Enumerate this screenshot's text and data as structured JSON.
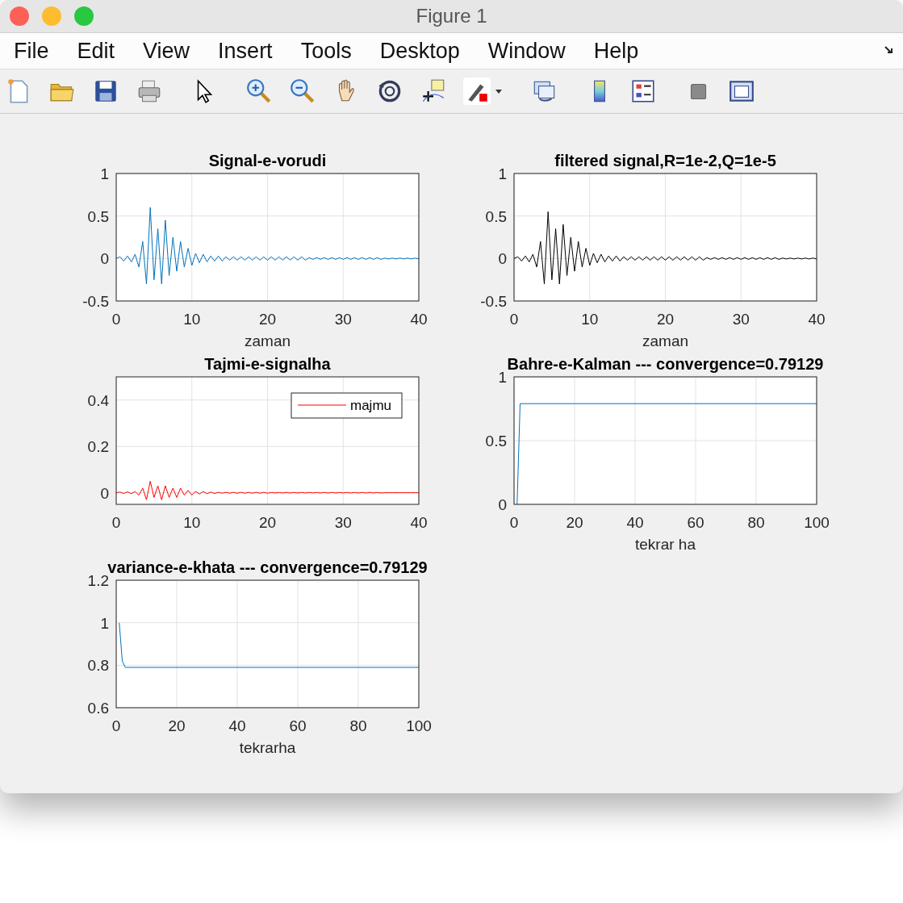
{
  "window": {
    "title": "Figure 1"
  },
  "menu": [
    "File",
    "Edit",
    "View",
    "Insert",
    "Tools",
    "Desktop",
    "Window",
    "Help"
  ],
  "plots": [
    {
      "chart_data": {
        "type": "line",
        "title": "Signal-e-vorudi",
        "xlabel": "zaman",
        "grid": true,
        "x": [
          0,
          0.5,
          1,
          1.5,
          2,
          2.5,
          3,
          3.5,
          4,
          4.5,
          5,
          5.5,
          6,
          6.5,
          7,
          7.5,
          8,
          8.5,
          9,
          9.5,
          10,
          10.5,
          11,
          11.5,
          12,
          12.5,
          13,
          13.5,
          14,
          14.5,
          15,
          15.5,
          16,
          16.5,
          17,
          17.5,
          18,
          18.5,
          19,
          19.5,
          20,
          20.5,
          21,
          21.5,
          22,
          22.5,
          23,
          23.5,
          24,
          24.5,
          25,
          25.5,
          26,
          26.5,
          27,
          27.5,
          28,
          28.5,
          29,
          29.5,
          30,
          30.5,
          31,
          31.5,
          32,
          32.5,
          33,
          33.5,
          34,
          34.5,
          35,
          35.5,
          36,
          36.5,
          37,
          37.5,
          38,
          38.5,
          39,
          39.5,
          40
        ],
        "xlim": [
          0,
          40
        ],
        "ylim": [
          -0.5,
          1
        ],
        "xticks": [
          0,
          10,
          20,
          30,
          40
        ],
        "yticks": [
          -0.5,
          0,
          0.5,
          1
        ],
        "series": [
          {
            "color": "#0072bd",
            "values": [
              0,
              0.02,
              -0.03,
              0.03,
              -0.04,
              0.05,
              -0.1,
              0.2,
              -0.3,
              0.6,
              -0.25,
              0.35,
              -0.3,
              0.45,
              -0.2,
              0.25,
              -0.15,
              0.2,
              -0.1,
              0.12,
              -0.08,
              0.06,
              -0.05,
              0.05,
              -0.04,
              0.03,
              -0.03,
              0.03,
              -0.03,
              0.02,
              -0.02,
              0.02,
              -0.02,
              0.02,
              -0.02,
              0.02,
              -0.02,
              0.02,
              -0.02,
              0.02,
              -0.02,
              0.02,
              -0.02,
              0.02,
              -0.02,
              0.02,
              -0.02,
              0.02,
              -0.02,
              0.02,
              -0.02,
              0.01,
              -0.01,
              0.01,
              -0.01,
              0.01,
              -0.01,
              0.01,
              -0.01,
              0.01,
              -0.01,
              0.01,
              -0.01,
              0.01,
              -0.01,
              0.01,
              -0.01,
              0.01,
              -0.01,
              0.01,
              -0.01,
              0.005,
              -0.005,
              0.005,
              -0.005,
              0.005,
              -0.005,
              0.005,
              -0.005,
              0.005,
              -0.005
            ]
          }
        ]
      }
    },
    {
      "chart_data": {
        "type": "line",
        "title": "filtered signal,R=1e-2,Q=1e-5",
        "xlabel": "zaman",
        "grid": true,
        "x": [
          0,
          0.5,
          1,
          1.5,
          2,
          2.5,
          3,
          3.5,
          4,
          4.5,
          5,
          5.5,
          6,
          6.5,
          7,
          7.5,
          8,
          8.5,
          9,
          9.5,
          10,
          10.5,
          11,
          11.5,
          12,
          12.5,
          13,
          13.5,
          14,
          14.5,
          15,
          15.5,
          16,
          16.5,
          17,
          17.5,
          18,
          18.5,
          19,
          19.5,
          20,
          20.5,
          21,
          21.5,
          22,
          22.5,
          23,
          23.5,
          24,
          24.5,
          25,
          25.5,
          26,
          26.5,
          27,
          27.5,
          28,
          28.5,
          29,
          29.5,
          30,
          30.5,
          31,
          31.5,
          32,
          32.5,
          33,
          33.5,
          34,
          34.5,
          35,
          35.5,
          36,
          36.5,
          37,
          37.5,
          38,
          38.5,
          39,
          39.5,
          40
        ],
        "xlim": [
          0,
          40
        ],
        "ylim": [
          -0.5,
          1
        ],
        "xticks": [
          0,
          10,
          20,
          30,
          40
        ],
        "yticks": [
          -0.5,
          0,
          0.5,
          1
        ],
        "series": [
          {
            "color": "#000000",
            "values": [
              0,
              0.02,
              -0.03,
              0.03,
              -0.04,
              0.05,
              -0.1,
              0.2,
              -0.3,
              0.55,
              -0.25,
              0.35,
              -0.3,
              0.4,
              -0.2,
              0.25,
              -0.15,
              0.2,
              -0.1,
              0.12,
              -0.08,
              0.06,
              -0.05,
              0.05,
              -0.04,
              0.03,
              -0.03,
              0.03,
              -0.03,
              0.02,
              -0.02,
              0.02,
              -0.02,
              0.02,
              -0.02,
              0.02,
              -0.02,
              0.02,
              -0.02,
              0.02,
              -0.02,
              0.02,
              -0.02,
              0.02,
              -0.02,
              0.02,
              -0.02,
              0.02,
              -0.02,
              0.02,
              -0.02,
              0.01,
              -0.01,
              0.01,
              -0.01,
              0.01,
              -0.01,
              0.01,
              -0.01,
              0.01,
              -0.01,
              0.01,
              -0.01,
              0.01,
              -0.01,
              0.01,
              -0.01,
              0.01,
              -0.01,
              0.01,
              -0.01,
              0.005,
              -0.005,
              0.005,
              -0.005,
              0.005,
              -0.005,
              0.005,
              -0.005,
              0.005,
              -0.005
            ]
          }
        ]
      }
    },
    {
      "chart_data": {
        "type": "line",
        "title": "Tajmi-e-signalha",
        "grid": true,
        "x": [
          0,
          0.5,
          1,
          1.5,
          2,
          2.5,
          3,
          3.5,
          4,
          4.5,
          5,
          5.5,
          6,
          6.5,
          7,
          7.5,
          8,
          8.5,
          9,
          9.5,
          10,
          10.5,
          11,
          11.5,
          12,
          12.5,
          13,
          13.5,
          14,
          14.5,
          15,
          15.5,
          16,
          16.5,
          17,
          17.5,
          18,
          18.5,
          19,
          19.5,
          20,
          20.5,
          21,
          21.5,
          22,
          22.5,
          23,
          23.5,
          24,
          24.5,
          25,
          25.5,
          26,
          26.5,
          27,
          27.5,
          28,
          28.5,
          29,
          29.5,
          30,
          30.5,
          31,
          31.5,
          32,
          32.5,
          33,
          33.5,
          34,
          34.5,
          35,
          35.5,
          36,
          36.5,
          37,
          37.5,
          38,
          38.5,
          39,
          39.5,
          40
        ],
        "xlim": [
          0,
          40
        ],
        "ylim": [
          -0.05,
          0.5
        ],
        "xticks": [
          0,
          10,
          20,
          30,
          40
        ],
        "yticks": [
          0,
          0.2,
          0.4
        ],
        "series": [
          {
            "name": "majmu",
            "color": "#ff0000",
            "values": [
              0,
              0.003,
              -0.003,
              0.004,
              -0.004,
              0.005,
              -0.01,
              0.02,
              -0.03,
              0.05,
              -0.02,
              0.03,
              -0.03,
              0.03,
              -0.02,
              0.02,
              -0.02,
              0.02,
              -0.01,
              0.01,
              -0.01,
              0.006,
              -0.005,
              0.005,
              -0.004,
              0.003,
              -0.003,
              0.002,
              -0.002,
              0.002,
              -0.002,
              0.002,
              -0.002,
              0.002,
              -0.002,
              0.002,
              -0.002,
              0.002,
              -0.002,
              0.002,
              -0.002,
              0.001,
              -0.001,
              0.001,
              -0.001,
              0.001,
              -0.001,
              0.001,
              -0.001,
              0.001,
              -0.001,
              0.001,
              -0.001,
              0.001,
              -0.001,
              0.001,
              -0.001,
              0.001,
              -0.001,
              0.001,
              -0.001,
              0.001,
              -0.001,
              0.001,
              -0.001,
              0.001,
              -0.001,
              0.001,
              -0.001,
              0.001,
              -0.001,
              0,
              0,
              0,
              0,
              0,
              0,
              0,
              0,
              0,
              0
            ]
          }
        ]
      }
    },
    {
      "chart_data": {
        "type": "line",
        "title": "Bahre-e-Kalman --- convergence=0.79129",
        "xlabel": "tekrar ha",
        "grid": true,
        "x": [
          1,
          2,
          100
        ],
        "xlim": [
          0,
          100
        ],
        "ylim": [
          0,
          1
        ],
        "xticks": [
          0,
          20,
          40,
          60,
          80,
          100
        ],
        "yticks": [
          0,
          0.5,
          1
        ],
        "series": [
          {
            "color": "#0072bd",
            "values": [
              0,
              0.79,
              0.79
            ]
          }
        ]
      }
    },
    {
      "chart_data": {
        "type": "line",
        "title": "variance-e-khata --- convergence=0.79129",
        "xlabel": "tekrarha",
        "grid": true,
        "x": [
          1,
          2,
          3,
          100
        ],
        "xlim": [
          0,
          100
        ],
        "ylim": [
          0.6,
          1.2
        ],
        "xticks": [
          0,
          20,
          40,
          60,
          80,
          100
        ],
        "yticks": [
          0.6,
          0.8,
          1,
          1.2
        ],
        "series": [
          {
            "color": "#0072bd",
            "values": [
              1,
              0.82,
              0.79,
              0.79
            ]
          }
        ]
      }
    }
  ]
}
